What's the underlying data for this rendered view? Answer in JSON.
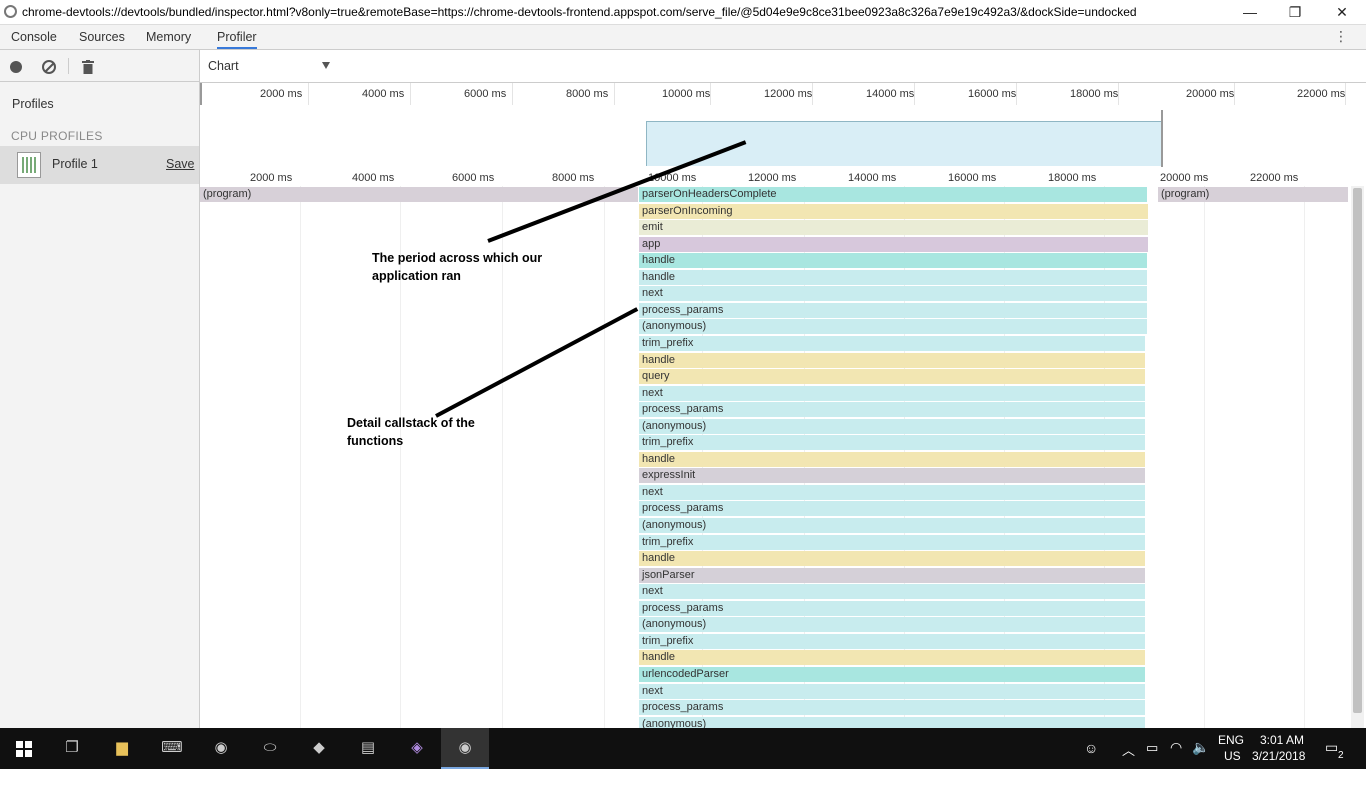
{
  "window": {
    "title": "chrome-devtools://devtools/bundled/inspector.html?v8only=true&remoteBase=https://chrome-devtools-frontend.appspot.com/serve_file/@5d04e9e9c8ce31bee0923a8c326a7e9e19c492a3/&dockSide=undocked",
    "min_glyph": "—",
    "max_glyph": "❐",
    "close_glyph": "✕"
  },
  "tabs": [
    {
      "label": "Console"
    },
    {
      "label": "Sources"
    },
    {
      "label": "Memory"
    },
    {
      "label": "Profiler"
    }
  ],
  "toolbar": {
    "view_select": "Chart"
  },
  "sidebar": {
    "profiles_label": "Profiles",
    "section_label": "CPU PROFILES",
    "profile_name": "Profile 1",
    "save_label": "Save"
  },
  "overview_ticks": [
    "2000 ms",
    "4000 ms",
    "6000 ms",
    "8000 ms",
    "10000 ms",
    "12000 ms",
    "14000 ms",
    "16000 ms",
    "18000 ms",
    "20000 ms",
    "22000 ms"
  ],
  "ruler_ticks": [
    "2000 ms",
    "4000 ms",
    "6000 ms",
    "8000 ms",
    "10000 ms",
    "12000 ms",
    "14000 ms",
    "16000 ms",
    "18000 ms",
    "20000 ms",
    "22000 ms"
  ],
  "colors": {
    "teal": "#a8e6e0",
    "yellow": "#f2e6b2",
    "lightblue": "#c8ecee",
    "purple": "#d7c8dc",
    "grey": "#d5d0d8",
    "program": "#d7d0d8",
    "paleyellow": "#eaecd6"
  },
  "program_bars": [
    {
      "label": "(program)",
      "side": "left"
    },
    {
      "label": "(program)",
      "side": "right"
    }
  ],
  "flame": [
    {
      "label": "parserOnHeadersComplete",
      "color": "teal"
    },
    {
      "label": "parserOnIncoming",
      "color": "yellow"
    },
    {
      "label": "emit",
      "color": "paleyellow"
    },
    {
      "label": "app",
      "color": "purple"
    },
    {
      "label": "handle",
      "color": "teal"
    },
    {
      "label": "handle",
      "color": "lightblue"
    },
    {
      "label": "next",
      "color": "lightblue"
    },
    {
      "label": "process_params",
      "color": "lightblue"
    },
    {
      "label": "(anonymous)",
      "color": "lightblue"
    },
    {
      "label": "trim_prefix",
      "color": "lightblue"
    },
    {
      "label": "handle",
      "color": "yellow"
    },
    {
      "label": "query",
      "color": "yellow"
    },
    {
      "label": "next",
      "color": "lightblue"
    },
    {
      "label": "process_params",
      "color": "lightblue"
    },
    {
      "label": "(anonymous)",
      "color": "lightblue"
    },
    {
      "label": "trim_prefix",
      "color": "lightblue"
    },
    {
      "label": "handle",
      "color": "yellow"
    },
    {
      "label": "expressInit",
      "color": "grey"
    },
    {
      "label": "next",
      "color": "lightblue"
    },
    {
      "label": "process_params",
      "color": "lightblue"
    },
    {
      "label": "(anonymous)",
      "color": "lightblue"
    },
    {
      "label": "trim_prefix",
      "color": "lightblue"
    },
    {
      "label": "handle",
      "color": "yellow"
    },
    {
      "label": "jsonParser",
      "color": "grey"
    },
    {
      "label": "next",
      "color": "lightblue"
    },
    {
      "label": "process_params",
      "color": "lightblue"
    },
    {
      "label": "(anonymous)",
      "color": "lightblue"
    },
    {
      "label": "trim_prefix",
      "color": "lightblue"
    },
    {
      "label": "handle",
      "color": "yellow"
    },
    {
      "label": "urlencodedParser",
      "color": "teal"
    },
    {
      "label": "next",
      "color": "lightblue"
    },
    {
      "label": "process_params",
      "color": "lightblue"
    },
    {
      "label": "(anonymous)",
      "color": "lightblue"
    }
  ],
  "annotations": {
    "period": "The period across which our application ran",
    "detail": "Detail callstack of the functions"
  },
  "tray": {
    "lang": "ENG",
    "region": "US",
    "time": "3:01 AM",
    "date": "3/21/2018",
    "notif": "2"
  }
}
